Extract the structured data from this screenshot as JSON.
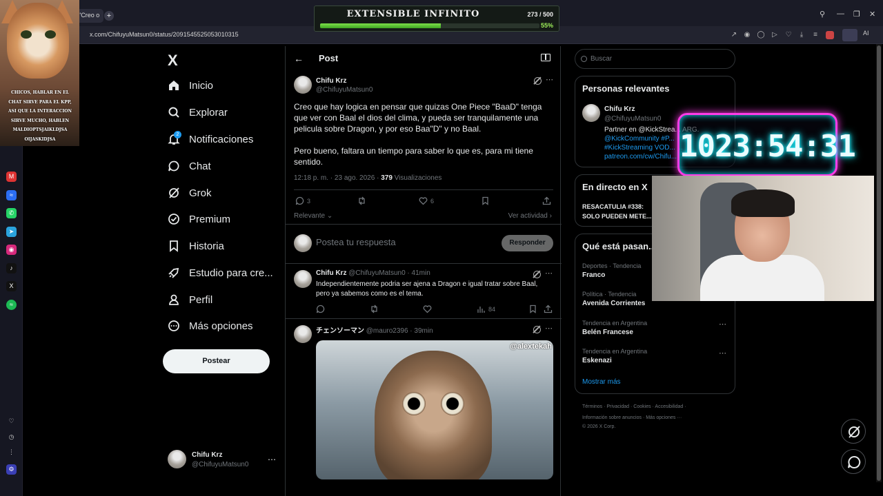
{
  "browser": {
    "tab_title": "\"Creo o",
    "new_tab": "+",
    "url": "x.com/ChifuyuMatsun0/status/2091545525053010315",
    "ai_label": "AI"
  },
  "overlays": {
    "cat_text": "CHICOS, HABLAR EN EL CHAT SIRVE PARA EL KPP, ASI QUE LA INTERACCION SIRVE MUCHO, HABLEN MALDIOPTSJAIKLDJSA OIJASKIDJSA",
    "extensible": {
      "title": "EXTENSIBLE INFINITO",
      "count": "273 / 500",
      "progress": 0.55,
      "percent": "55%"
    },
    "timer": "1023:54:31"
  },
  "nav": {
    "logo": "X",
    "items": [
      {
        "label": "Inicio",
        "icon": "home-icon"
      },
      {
        "label": "Explorar",
        "icon": "search-icon"
      },
      {
        "label": "Notificaciones",
        "icon": "bell-icon"
      },
      {
        "label": "Chat",
        "icon": "chat-icon"
      },
      {
        "label": "Grok",
        "icon": "grok-icon"
      },
      {
        "label": "Premium",
        "icon": "verified-icon"
      },
      {
        "label": "Historia",
        "icon": "bookmark-icon"
      },
      {
        "label": "Estudio para cre...",
        "icon": "rocket-icon"
      },
      {
        "label": "Perfil",
        "icon": "person-icon"
      },
      {
        "label": "Más opciones",
        "icon": "more-icon"
      }
    ],
    "notif_badge": "2",
    "post_button": "Postear",
    "account": {
      "name": "Chifu Krz",
      "handle": "@ChifuyuMatsun0"
    }
  },
  "post": {
    "header_title": "Post",
    "author_name": "Chifu Krz",
    "author_handle": "@ChifuyuMatsun0",
    "paragraph1": "Creo que hay logica en pensar que quizas One Piece \"BaaD\" tenga que ver con Baal el dios del clima, y pueda ser tranquilamente una pelicula sobre Dragon, y por eso Baa\"D\" y no Baal.",
    "paragraph2": "Pero bueno, faltara un tiempo para saber lo que es, para mi tiene sentido.",
    "time": "12:18 p. m. · 23 ago. 2026 · ",
    "views_count": "379",
    "views_label": " Visualizaciones",
    "replies": "3",
    "likes": "6",
    "relevant": "Relevante",
    "see_activity": "Ver actividad",
    "reply_placeholder": "Postea tu respuesta",
    "reply_button": "Responder"
  },
  "replies": [
    {
      "name": "Chifu Krz",
      "meta": "@ChifuyuMatsun0 · 41min",
      "text": "Independientemente podria ser ajena a Dragon e igual tratar sobre Baal, pero ya sabemos como es el tema.",
      "views": "84"
    },
    {
      "name": "チェンソーマン",
      "meta": "@mauro2396 · 39min",
      "watermark": "@alextekah"
    }
  ],
  "sidebar": {
    "search_placeholder": "Buscar",
    "relevant_title": "Personas relevantes",
    "person": {
      "name": "Chifu Krz",
      "handle": "@ChifuyuMatsun0",
      "bio_line1": "Partner en @KickStrea... ARG.",
      "bio_line2": "@KickCommunity #P...",
      "bio_line3": "#KickStreaming VOD... ...",
      "bio_line4": "patreon.com/cw/Chifu..."
    },
    "live_title": "En directo en X",
    "live_text1": "RESACATULIA #338:",
    "live_text2": "SOLO PUEDEN METE...",
    "trends_title": "Qué está pasan...",
    "trends": [
      {
        "category": "Deportes · Tendencia",
        "name": "Franco"
      },
      {
        "category": "Política · Tendencia",
        "name": "Avenida Corrientes"
      },
      {
        "category": "Tendencia en Argentina",
        "name": "Belén Francese"
      },
      {
        "category": "Tendencia en Argentina",
        "name": "Eskenazi"
      }
    ],
    "show_more": "Mostrar más",
    "footer_line1": "Términos  ·  Privacidad  ·  Cookies  ·  Accesibilidad  ·",
    "footer_line2": "Información sobre anuncios  ·  Más opciones ···",
    "footer_line3": "© 2026 X Corp."
  },
  "colors": {
    "accent": "#1d9bf0",
    "background": "#000000",
    "progress": "#4fbf2c",
    "timer_neon": "#ff3ce8"
  }
}
